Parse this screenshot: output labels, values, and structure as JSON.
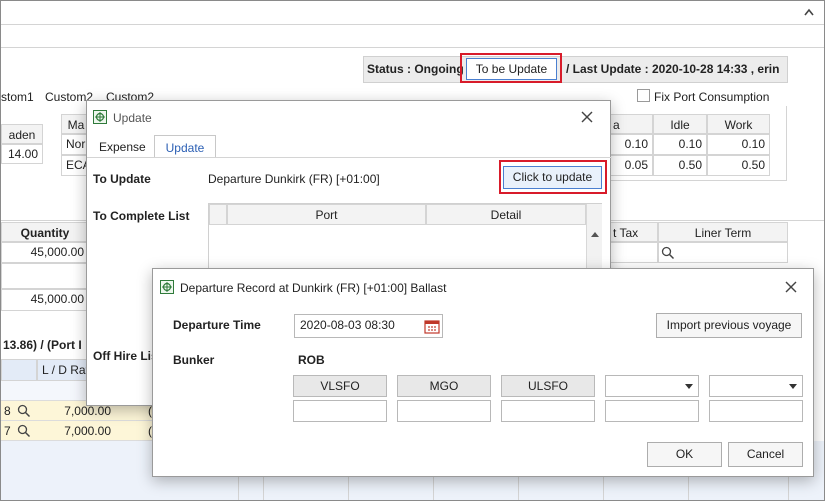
{
  "header": {
    "status_label": "Status : Ongoing",
    "to_be_update_btn": "To be Update",
    "last_update": "/ Last Update : 2020-10-28 14:33 , erin"
  },
  "bg": {
    "custom_tabs": [
      "stom1",
      "Custom2",
      "Custom2"
    ],
    "fix_port_consumption": "Fix Port Consumption",
    "laden_hdr": "aden",
    "laden_val": "14.00",
    "ma_hdr": "Ma",
    "ma_rows": [
      "Nor",
      "ECA"
    ],
    "a_hdr": "a",
    "idle_hdr": "Idle",
    "work_hdr": "Work",
    "cons_rows": [
      [
        "0.10",
        "0.10",
        "0.10"
      ],
      [
        "0.05",
        "0.50",
        "0.50"
      ]
    ],
    "quantity_hdr": "Quantity",
    "quantities": [
      "45,000.00",
      "45,000.00"
    ],
    "t_tax_hdr": "t Tax",
    "liner_term_hdr": "Liner Term",
    "port_summary": "13.86) / (Port I",
    "ld_rate_hdr": "L / D Rat",
    "ld_rows": [
      {
        "idx": "8",
        "val": "7,000.00",
        "c": "("
      },
      {
        "idx": "7",
        "val": "7,000.00",
        "c": "("
      }
    ]
  },
  "update_dialog": {
    "title": "Update",
    "tabs": [
      "Expense",
      "Update"
    ],
    "to_update_label": "To Update",
    "to_update_value": "Departure  Dunkirk (FR) [+01:00]",
    "click_to_update": "Click to update",
    "to_complete_label": "To Complete List",
    "col_port": "Port",
    "col_detail": "Detail",
    "off_hire_label": "Off Hire Lis"
  },
  "departure_dialog": {
    "title": "Departure Record at Dunkirk (FR) [+01:00] Ballast",
    "departure_time_label": "Departure Time",
    "departure_time_value": "2020-08-03 08:30",
    "import_btn": "Import previous voyage",
    "bunker_label": "Bunker",
    "rob_label": "ROB",
    "fuels": [
      "VLSFO",
      "MGO",
      "ULSFO"
    ],
    "ok": "OK",
    "cancel": "Cancel"
  }
}
